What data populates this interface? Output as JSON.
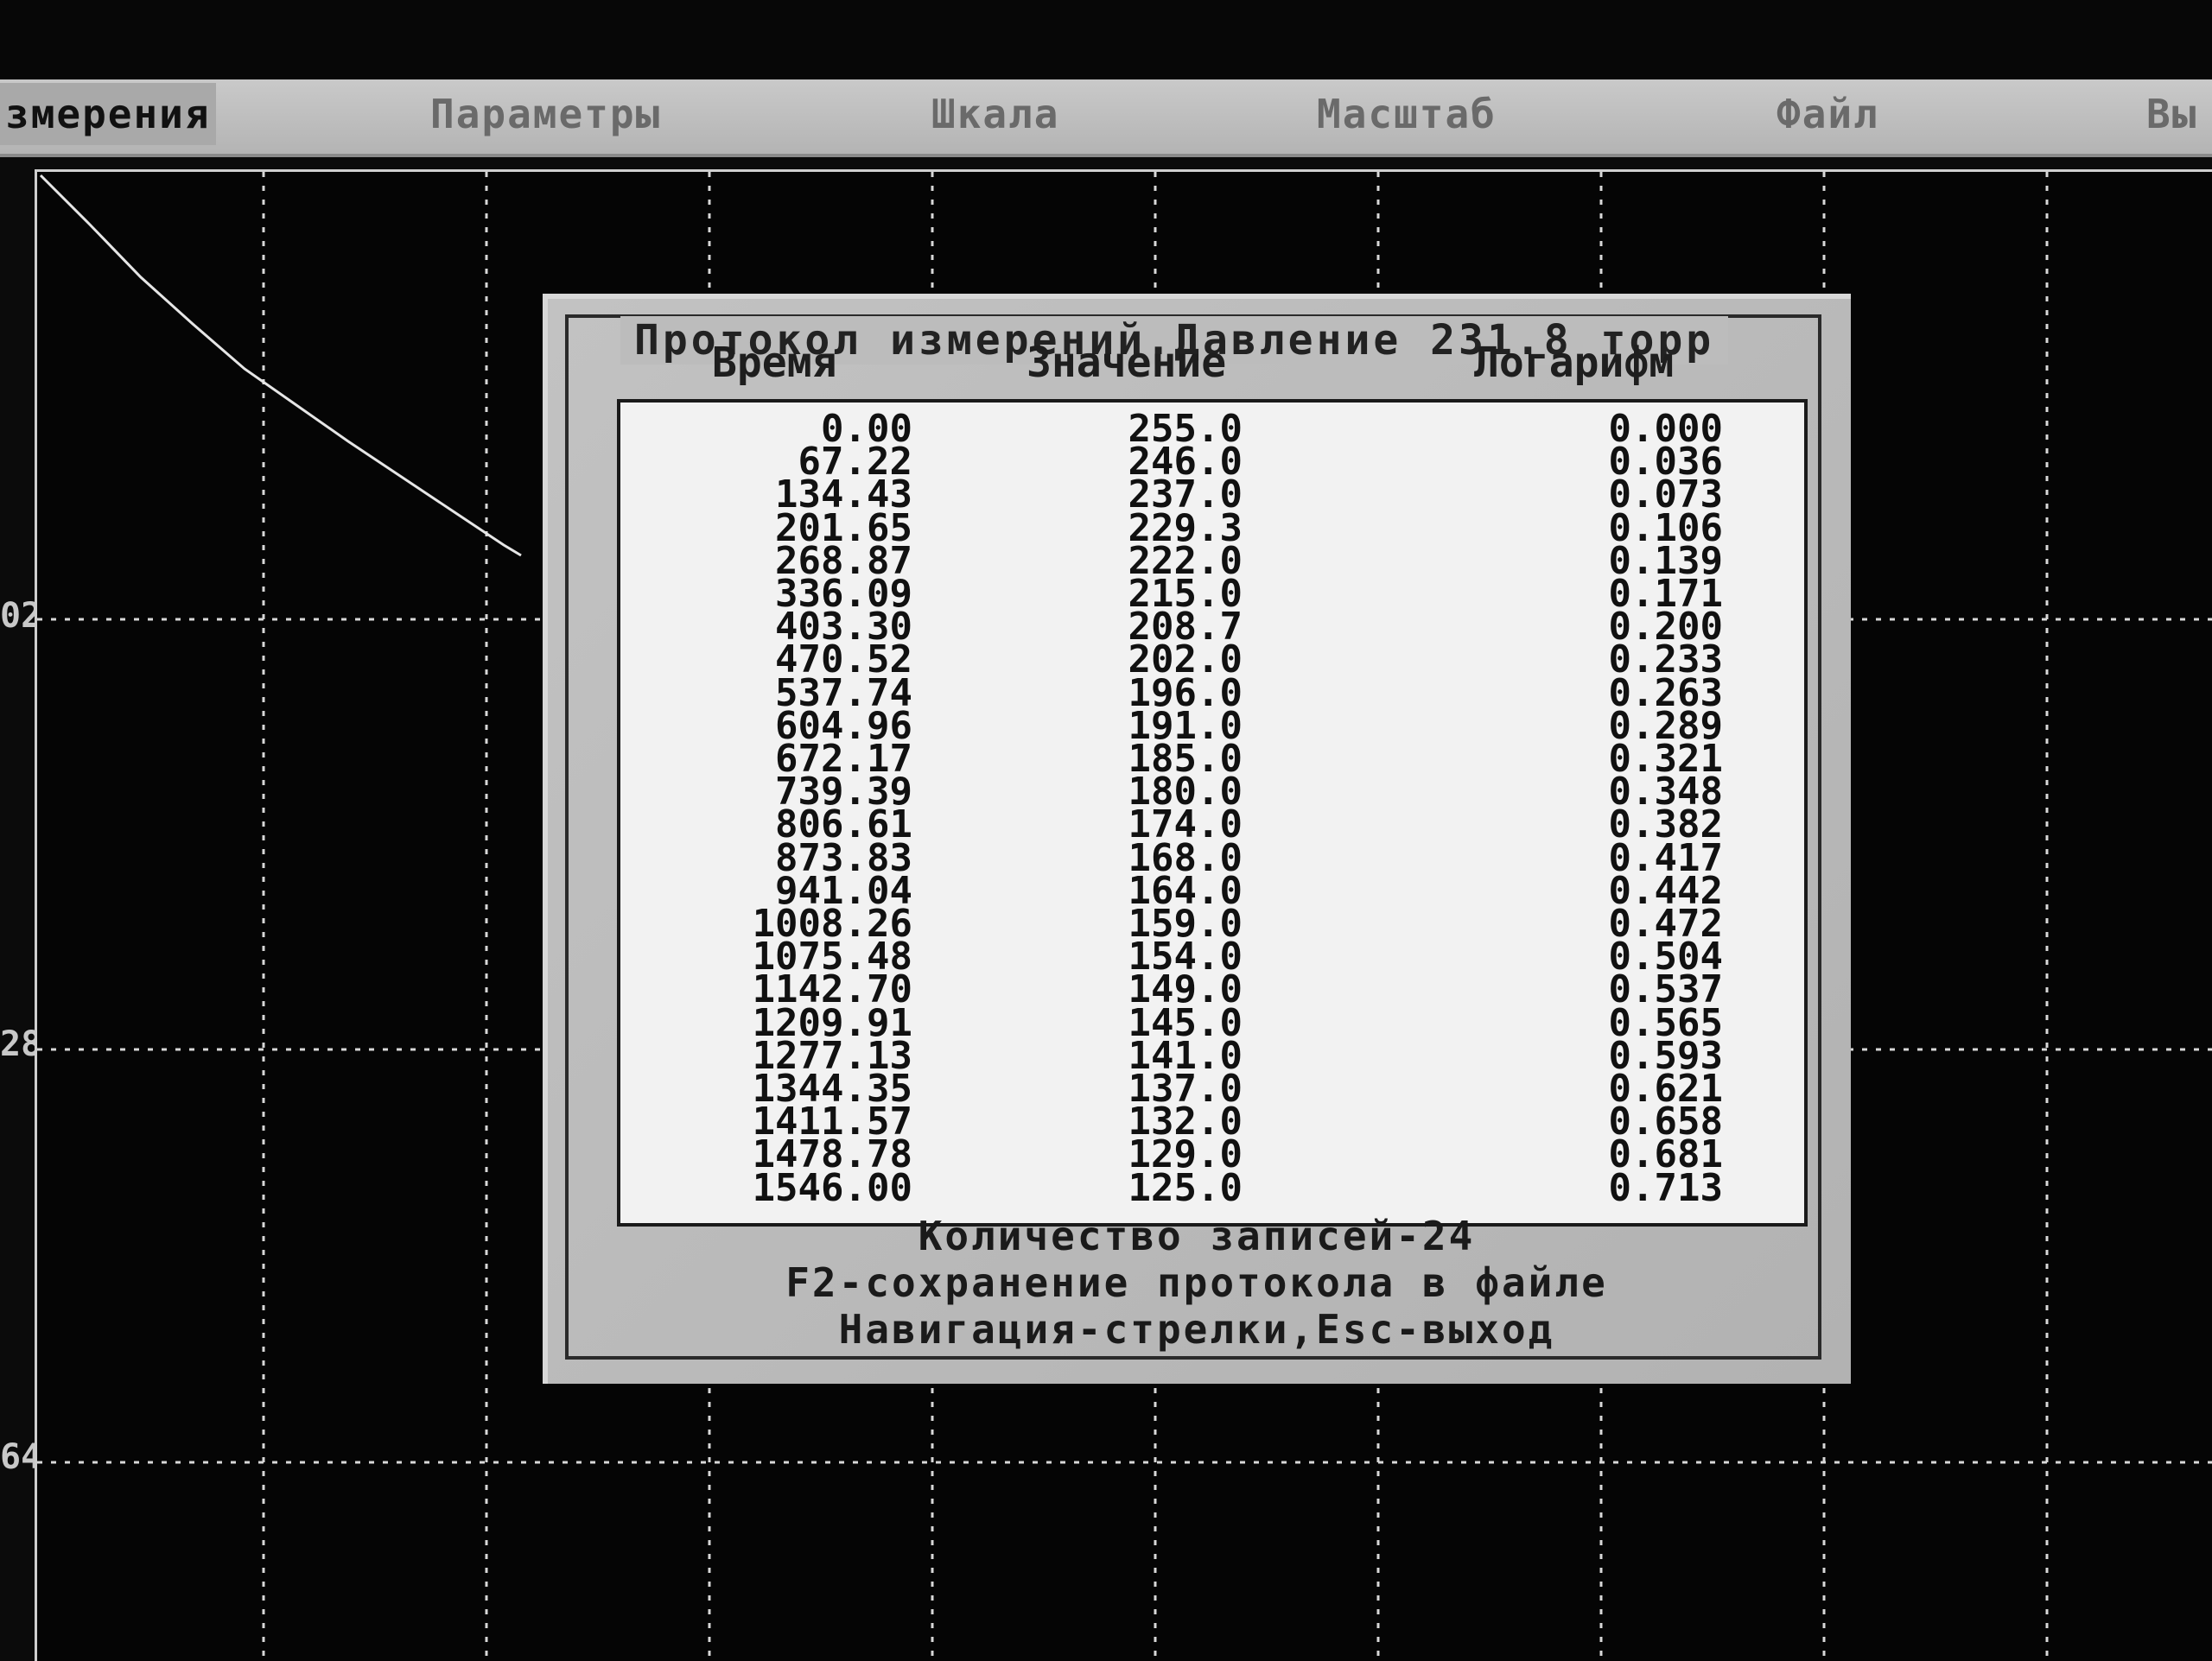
{
  "menu": {
    "items": [
      {
        "label": "змерения",
        "active": true
      },
      {
        "label": "Параметры",
        "active": false
      },
      {
        "label": "Шкала",
        "active": false
      },
      {
        "label": "Масштаб",
        "active": false
      },
      {
        "label": "Файл",
        "active": false
      },
      {
        "label": "Вы",
        "active": false
      }
    ]
  },
  "plot": {
    "y_labels": [
      "02",
      "28",
      "64"
    ],
    "colors": {
      "background": "#050505",
      "grid": "#d8d8d8",
      "curve": "#e6e6e6"
    }
  },
  "dialog": {
    "title": "Протокол измерений.Давление 231.8 торр",
    "headers": {
      "time": "Время",
      "value": "Значение",
      "log": "Логарифм"
    },
    "rows": [
      [
        "0.00",
        "255.0",
        "0.000"
      ],
      [
        "67.22",
        "246.0",
        "0.036"
      ],
      [
        "134.43",
        "237.0",
        "0.073"
      ],
      [
        "201.65",
        "229.3",
        "0.106"
      ],
      [
        "268.87",
        "222.0",
        "0.139"
      ],
      [
        "336.09",
        "215.0",
        "0.171"
      ],
      [
        "403.30",
        "208.7",
        "0.200"
      ],
      [
        "470.52",
        "202.0",
        "0.233"
      ],
      [
        "537.74",
        "196.0",
        "0.263"
      ],
      [
        "604.96",
        "191.0",
        "0.289"
      ],
      [
        "672.17",
        "185.0",
        "0.321"
      ],
      [
        "739.39",
        "180.0",
        "0.348"
      ],
      [
        "806.61",
        "174.0",
        "0.382"
      ],
      [
        "873.83",
        "168.0",
        "0.417"
      ],
      [
        "941.04",
        "164.0",
        "0.442"
      ],
      [
        "1008.26",
        "159.0",
        "0.472"
      ],
      [
        "1075.48",
        "154.0",
        "0.504"
      ],
      [
        "1142.70",
        "149.0",
        "0.537"
      ],
      [
        "1209.91",
        "145.0",
        "0.565"
      ],
      [
        "1277.13",
        "141.0",
        "0.593"
      ],
      [
        "1344.35",
        "137.0",
        "0.621"
      ],
      [
        "1411.57",
        "132.0",
        "0.658"
      ],
      [
        "1478.78",
        "129.0",
        "0.681"
      ],
      [
        "1546.00",
        "125.0",
        "0.713"
      ]
    ],
    "record_count": "Количество записей-24",
    "save_hint": "F2-сохранение протокола в файле",
    "nav_hint": "Навигация-стрелки,Esc-выход"
  }
}
